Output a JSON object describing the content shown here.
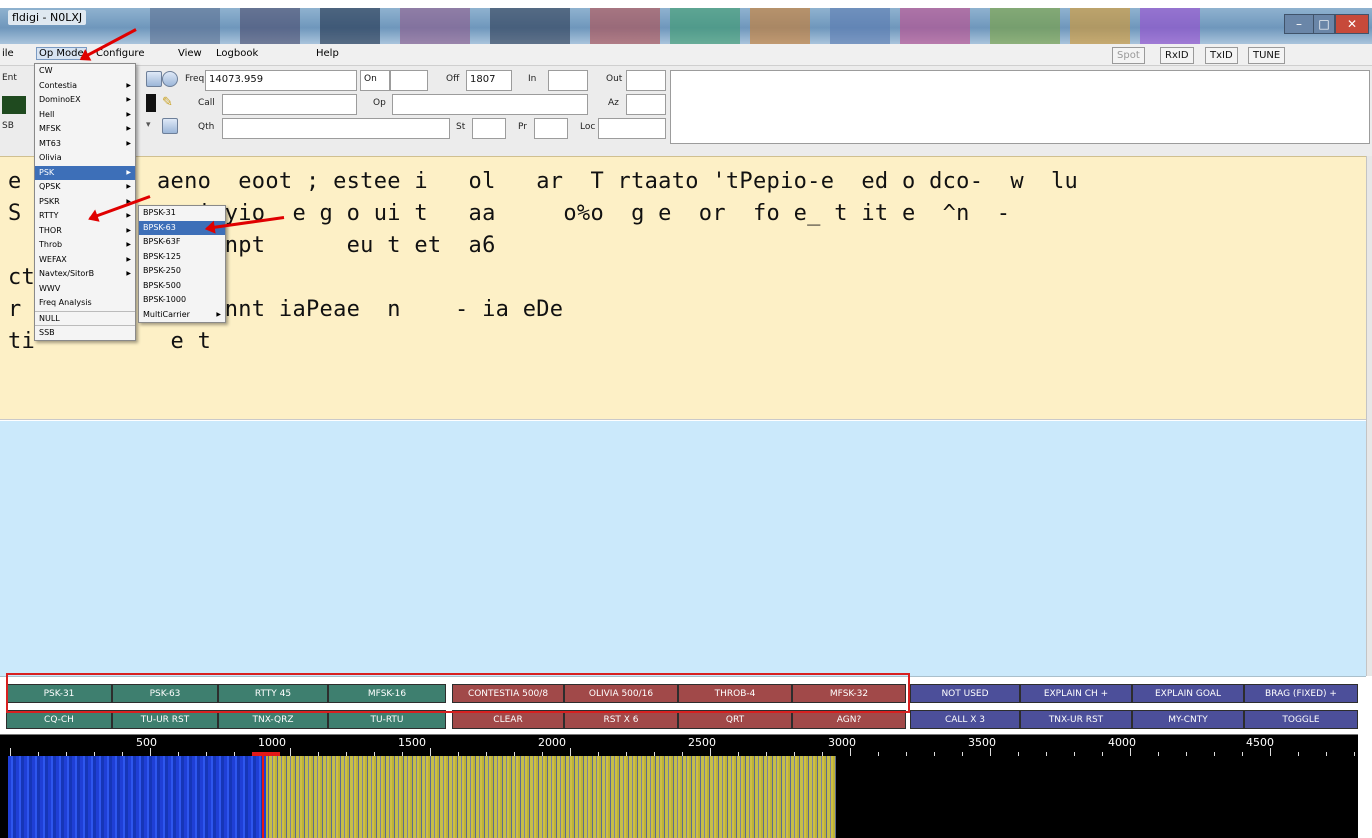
{
  "window": {
    "title": "fldigi - N0LXJ",
    "btn_min": "–",
    "btn_max": "□",
    "btn_close": "✕"
  },
  "menubar": {
    "items": [
      {
        "label": "ile"
      },
      {
        "label": "Op Mode"
      },
      {
        "label": "Configure"
      },
      {
        "label": "View"
      },
      {
        "label": "Logbook"
      },
      {
        "label": "Help"
      }
    ],
    "spot": "Spot",
    "rxid": "RxID",
    "txid": "TxID",
    "tune": "TUNE"
  },
  "log": {
    "freq_label": "Freq",
    "freq_value": "14073.959",
    "on_label": "On",
    "on_value": "",
    "off_label": "Off",
    "off_value": "1807",
    "in_label": "In",
    "in_value": "",
    "out_label": "Out",
    "out_value": "",
    "call_label": "Call",
    "call_value": "",
    "op_label": "Op",
    "op_value": "",
    "az_label": "Az",
    "az_value": "",
    "qth_label": "Qth",
    "qth_value": "",
    "st_label": "St",
    "st_value": "",
    "pr_label": "Pr",
    "pr_value": "",
    "loc_label": "Loc",
    "loc_value": "",
    "left_fragment_1": "Ent",
    "left_fragment_3": "SB"
  },
  "rx_text": [
    "e          aeno  eoot ; estee i   ol   ar  T rtaato 'tPepio-e  ed o dco-  w  lu",
    "S           e i yio  e g o ui t   aa     o%o  g e  or  fo e_ t it e  ^n  -",
    "            lt% npt      eu t et  a6",
    "ct",
    "r           e  annt iaPeae  n    - ia eDe",
    "ti          e t"
  ],
  "macros": {
    "row1": [
      "PSK-31",
      "PSK-63",
      "RTTY 45",
      "MFSK-16",
      "CONTESTIA 500/8",
      "OLIVIA 500/16",
      "THROB-4",
      "MFSK-32",
      "NOT USED",
      "EXPLAIN CH +",
      "EXPLAIN GOAL",
      "BRAG (FIXED) +"
    ],
    "row2": [
      "CQ-CH",
      "TU-UR RST",
      "TNX-QRZ",
      "TU-RTU",
      "CLEAR",
      "RST X 6",
      "QRT",
      "AGN?",
      "CALL X 3",
      "TNX-UR RST",
      "MY-CNTY",
      "TOGGLE"
    ]
  },
  "ruler": {
    "labels": [
      "500",
      "1000",
      "1500",
      "2000",
      "2500",
      "3000",
      "3500",
      "4000",
      "4500"
    ]
  },
  "opmode_menu": [
    "CW",
    "Contestia",
    "DominoEX",
    "Hell",
    "MFSK",
    "MT63",
    "Olivia",
    "PSK",
    "QPSK",
    "PSKR",
    "RTTY",
    "THOR",
    "Throb",
    "WEFAX",
    "Navtex/SitorB",
    "WWV",
    "Freq Analysis",
    "NULL",
    "SSB"
  ],
  "psk_submenu": [
    "BPSK-31",
    "BPSK-63",
    "BPSK-63F",
    "BPSK-125",
    "BPSK-250",
    "BPSK-500",
    "BPSK-1000",
    "MultiCarrier"
  ],
  "colors": {
    "rx_bg": "#fdf0c6",
    "tx_bg": "#cbe9fb",
    "menu_highlight": "#3d6fb8",
    "annotation": "#e00000"
  }
}
